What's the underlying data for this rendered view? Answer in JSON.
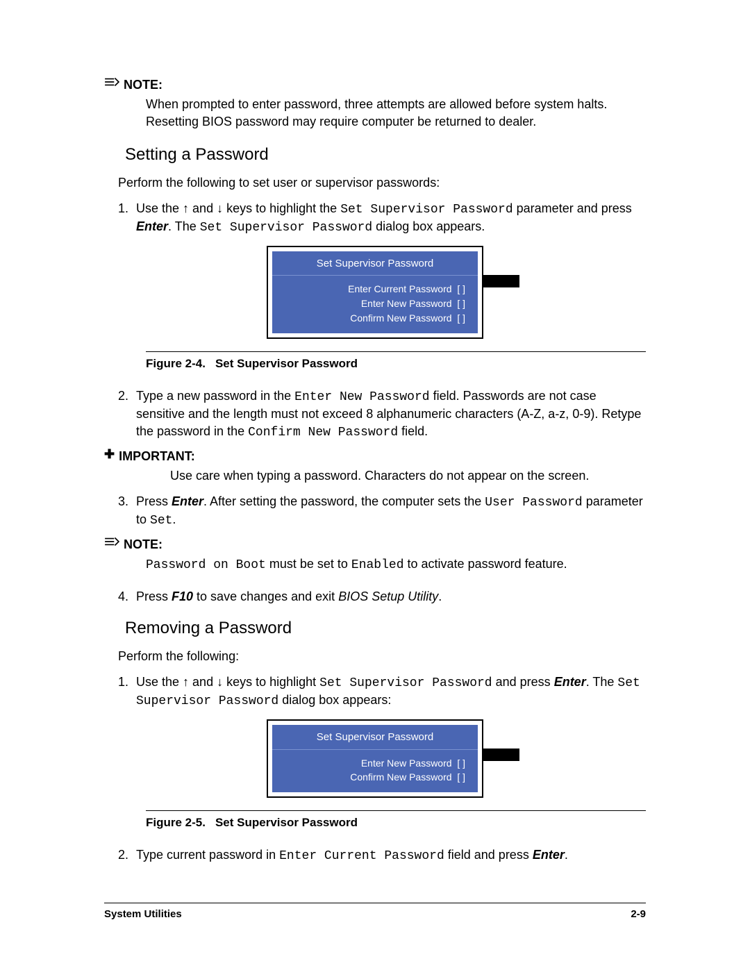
{
  "note1": {
    "label": "NOTE:",
    "body": "When prompted to enter password, three attempts are allowed before system halts. Resetting BIOS password may require computer be returned to dealer."
  },
  "section1": {
    "title": "Setting a Password",
    "intro": "Perform the following to set user or supervisor passwords:"
  },
  "step1": {
    "pre": "Use the ",
    "up": "↑",
    "mid1": " and ",
    "down": "↓",
    "mid2": " keys to highlight the ",
    "code1": "Set Supervisor Password",
    "mid3": " parameter and press ",
    "enter": "Enter",
    "mid4": ". The ",
    "code2": "Set Supervisor Password",
    "mid5": " dialog box appears."
  },
  "dialog1": {
    "title": "Set Supervisor Password",
    "l1": "Enter Current Password",
    "l2": "Enter New Password",
    "l3": "Confirm New Password",
    "br": "[      ]"
  },
  "fig1": {
    "num": "Figure 2-4.",
    "title": "Set Supervisor Password"
  },
  "step2": {
    "pre": "Type a new password in the ",
    "code1": "Enter New Password",
    "mid1": " field. Passwords are not case sensitive and the length must not exceed 8 alphanumeric characters (A-Z, a-z, 0-9). Retype the password in the ",
    "code2": "Confirm New Password",
    "mid2": " field."
  },
  "important": {
    "label": "IMPORTANT:",
    "body": "Use care when typing a password. Characters do not appear on the screen."
  },
  "step3": {
    "pre": "Press ",
    "enter": "Enter",
    "mid1": ". After setting the password, the computer sets the ",
    "code1": "User Password",
    "mid2": " parameter to ",
    "code2": "Set",
    "end": "."
  },
  "note2": {
    "label": "NOTE:",
    "code1": "Password on Boot",
    "mid1": " must be set to ",
    "code2": "Enabled",
    "mid2": " to activate password feature."
  },
  "step4": {
    "pre": "Press ",
    "f10": "F10",
    "mid1": " to save changes and exit ",
    "ital": "BIOS Setup Utility",
    "end": "."
  },
  "section2": {
    "title": "Removing a Password",
    "intro": "Perform the following:"
  },
  "rstep1": {
    "pre": "Use the ",
    "up": "↑",
    "mid1": " and ",
    "down": "↓",
    "mid2": " keys to highlight ",
    "code1": "Set Supervisor Password",
    "mid3": " and press ",
    "enter": "Enter",
    "mid4": ". The ",
    "code2": "Set Supervisor Password",
    "mid5": " dialog box appears:"
  },
  "dialog2": {
    "title": "Set Supervisor Password",
    "l1": "Enter New Password",
    "l2": "Confirm New Password",
    "br": "[      ]"
  },
  "fig2": {
    "num": "Figure 2-5.",
    "title": "Set Supervisor Password"
  },
  "rstep2": {
    "pre": "Type current password in ",
    "code1": "Enter Current Password",
    "mid1": " field and press ",
    "enter": "Enter",
    "end": "."
  },
  "footer": {
    "left": "System Utilities",
    "right": "2-9"
  }
}
